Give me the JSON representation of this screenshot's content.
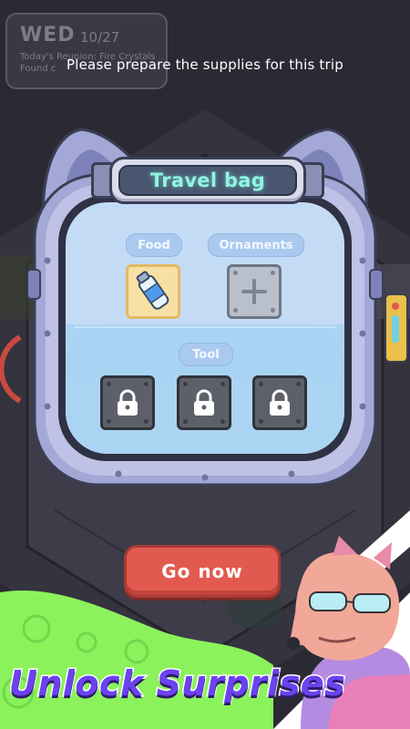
{
  "hud": {
    "day": "WED",
    "date": "10/27",
    "line1": "Today's Reunion: Fire Crystals",
    "line2": "Found c"
  },
  "prompt": "Please prepare the supplies for this trip",
  "bag": {
    "title": "Travel bag",
    "categories": {
      "food": "Food",
      "ornaments": "Ornaments",
      "tool": "Tool"
    },
    "slots": {
      "food_item_icon": "water-bottle-icon",
      "ornament_slot_icon": "plus-icon",
      "tool_slot_icon": "lock-icon"
    }
  },
  "actions": {
    "go_now": "Go now"
  },
  "promo": {
    "banner": "Unlock Surprises"
  },
  "colors": {
    "accent_teal": "#8ff4e0",
    "button_red": "#e25a4f",
    "promo_purple": "#6b42f0",
    "promo_green": "#8bf25b"
  }
}
